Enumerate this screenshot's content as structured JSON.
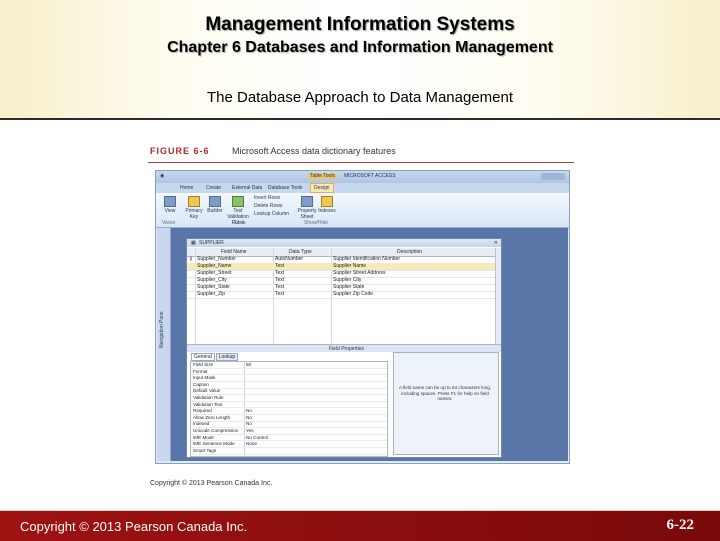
{
  "header": {
    "title": "Management Information Systems",
    "subtitle": "Chapter 6 Databases and Information Management",
    "slide_title": "The Database Approach to Data Management"
  },
  "figure": {
    "label": "FIGURE 6-6",
    "caption": "Microsoft Access data dictionary features",
    "copyright": "Copyright © 2013 Pearson Canada Inc."
  },
  "app": {
    "context_tab": "Table Tools",
    "app_name": "MICROSOFT ACCESS",
    "design_tab": "Design",
    "tabs": [
      "Home",
      "Create",
      "External Data",
      "Database Tools"
    ],
    "ribbon": {
      "view": "View",
      "primary_key": "Primary Key",
      "builder": "Builder",
      "test_rules": "Test Validation Rules",
      "insert_rows": "Insert Rows",
      "delete_rows": "Delete Rows",
      "lookup_column": "Lookup Column",
      "property_sheet": "Property Sheet",
      "indexes": "Indexes",
      "group_tools": "Tools",
      "group_views": "Views",
      "group_showhide": "Show/Hide"
    },
    "nav_pane": "Navigation Pane",
    "doc_title": "SUPPLIER",
    "columns": [
      "Field Name",
      "Data Type",
      "Description"
    ],
    "rows": [
      {
        "field": "Supplier_Number",
        "type": "AutoNumber",
        "desc": "Supplier Identification Number"
      },
      {
        "field": "Supplier_Name",
        "type": "Text",
        "desc": "Supplier Name"
      },
      {
        "field": "Supplier_Street",
        "type": "Text",
        "desc": "Supplier Street Address"
      },
      {
        "field": "Supplier_City",
        "type": "Text",
        "desc": "Supplier City"
      },
      {
        "field": "Supplier_State",
        "type": "Text",
        "desc": "Supplier State"
      },
      {
        "field": "Supplier_Zip",
        "type": "Text",
        "desc": "Supplier Zip Code"
      }
    ],
    "field_properties": "Field Properties",
    "prop_tabs": [
      "General",
      "Lookup"
    ],
    "properties": [
      {
        "name": "Field Size",
        "value": "50"
      },
      {
        "name": "Format",
        "value": ""
      },
      {
        "name": "Input Mask",
        "value": ""
      },
      {
        "name": "Caption",
        "value": ""
      },
      {
        "name": "Default Value",
        "value": ""
      },
      {
        "name": "Validation Rule",
        "value": ""
      },
      {
        "name": "Validation Text",
        "value": ""
      },
      {
        "name": "Required",
        "value": "No"
      },
      {
        "name": "Allow Zero Length",
        "value": "No"
      },
      {
        "name": "Indexed",
        "value": "No"
      },
      {
        "name": "Unicode Compression",
        "value": "Yes"
      },
      {
        "name": "IME Mode",
        "value": "No Control"
      },
      {
        "name": "IME Sentence Mode",
        "value": "None"
      },
      {
        "name": "Smart Tags",
        "value": ""
      }
    ],
    "help_text": "A field name can be up to 64 characters long, including spaces. Press F1 for help on field names."
  },
  "footer": {
    "copyright": "Copyright © 2013 Pearson Canada Inc.",
    "page": "6-22"
  },
  "colors": {
    "footer_bg": "#9e1212",
    "figure_label": "#b02a2a",
    "workspace": "#5877a8"
  }
}
